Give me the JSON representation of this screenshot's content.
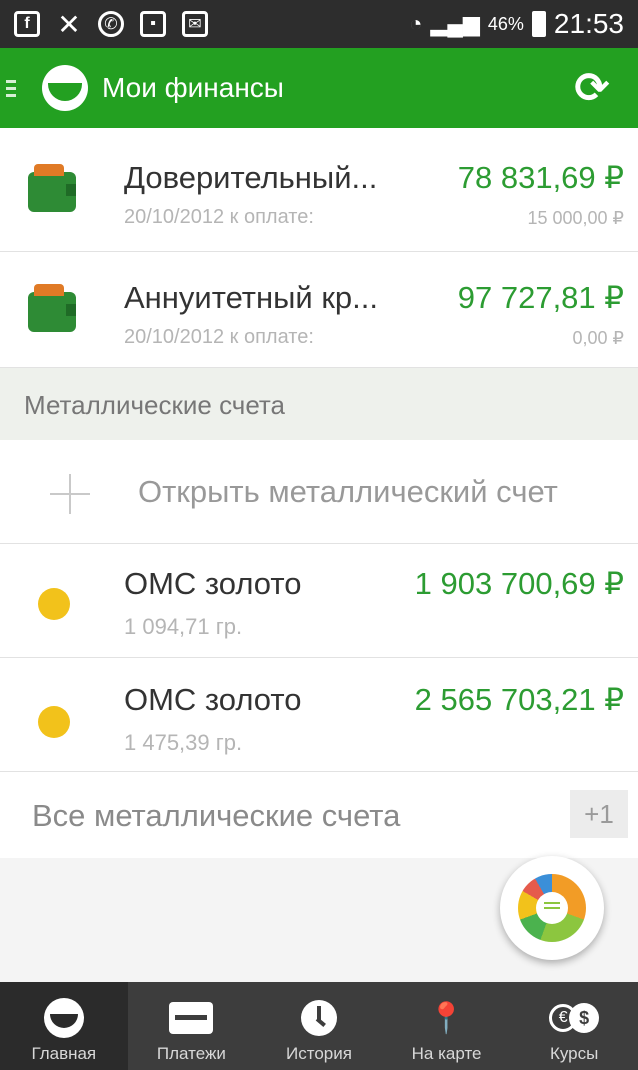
{
  "statusbar": {
    "icons": [
      "facebook-icon",
      "missed-call-icon",
      "whatsapp-icon",
      "gallery-icon",
      "mail-icon"
    ],
    "battery": "46%",
    "time": "21:53"
  },
  "appbar": {
    "title": "Мои финансы"
  },
  "loans": [
    {
      "title": "Доверительный...",
      "date": "20/10/2012 к оплате:",
      "amount": "78 831,69 ₽",
      "due": "15 000,00 ₽"
    },
    {
      "title": "Аннуитетный кр...",
      "date": "20/10/2012 к оплате:",
      "amount": "97 727,81 ₽",
      "due": "0,00 ₽"
    }
  ],
  "metal_section": {
    "header": "Металлические счета",
    "open_label": "Открыть металлический счет",
    "accounts": [
      {
        "title": "ОМС золото",
        "weight": "1 094,71  гр.",
        "amount": "1 903 700,69 ₽"
      },
      {
        "title": "ОМС золото",
        "weight": "1 475,39  гр.",
        "amount": "2 565 703,21 ₽"
      }
    ],
    "all_label": "Все металлические счета",
    "all_badge": "+1"
  },
  "colors": {
    "brand_green": "#23a021",
    "amount_green": "#2c9c32",
    "coin_gold": "#f2c21b"
  },
  "bottomnav": [
    {
      "label": "Главная",
      "icon": "sberbank-logo-icon",
      "active": true
    },
    {
      "label": "Платежи",
      "icon": "transfer-icon",
      "active": false
    },
    {
      "label": "История",
      "icon": "clock-icon",
      "active": false
    },
    {
      "label": "На карте",
      "icon": "map-pin-icon",
      "active": false
    },
    {
      "label": "Курсы",
      "icon": "currency-icon",
      "active": false
    }
  ]
}
